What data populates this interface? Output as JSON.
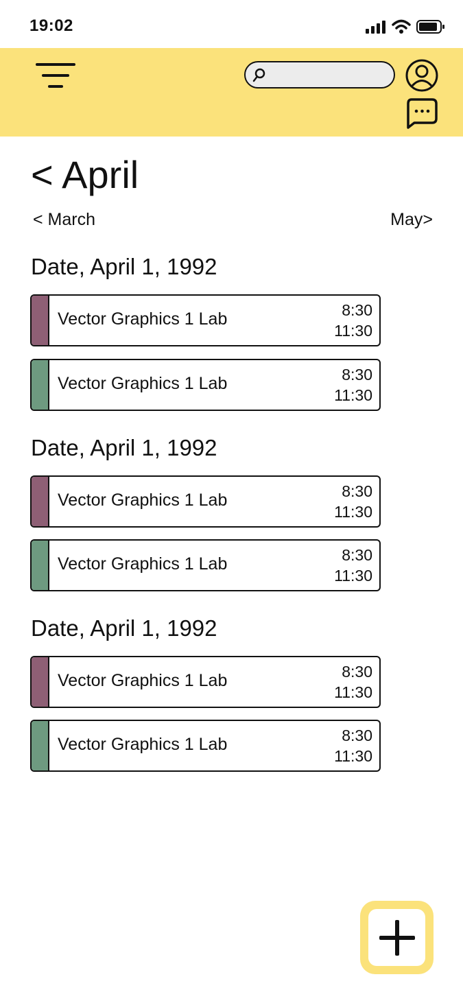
{
  "status_bar": {
    "time": "19:02",
    "icons": [
      "signal-icon",
      "wifi-icon",
      "battery-icon"
    ]
  },
  "header": {
    "background_color": "#fbe27b",
    "search": {
      "placeholder": "",
      "value": ""
    },
    "icons": [
      "menu-icon",
      "search-icon",
      "profile-icon",
      "chat-icon"
    ]
  },
  "month_nav": {
    "title": "< April",
    "prev_label": "< March",
    "next_label": "May>"
  },
  "event_colors": {
    "purple": "#8e5f75",
    "green": "#6e9a80"
  },
  "days": [
    {
      "heading": "Date, April 1, 1992",
      "events": [
        {
          "title": "Vector Graphics 1 Lab",
          "start": "8:30",
          "end": "11:30",
          "color": "#8e5f75"
        },
        {
          "title": "Vector Graphics 1 Lab",
          "start": "8:30",
          "end": "11:30",
          "color": "#6e9a80"
        }
      ]
    },
    {
      "heading": "Date, April 1, 1992",
      "events": [
        {
          "title": "Vector Graphics 1 Lab",
          "start": "8:30",
          "end": "11:30",
          "color": "#8e5f75"
        },
        {
          "title": "Vector Graphics 1 Lab",
          "start": "8:30",
          "end": "11:30",
          "color": "#6e9a80"
        }
      ]
    },
    {
      "heading": "Date, April 1, 1992",
      "events": [
        {
          "title": "Vector Graphics 1 Lab",
          "start": "8:30",
          "end": "11:30",
          "color": "#8e5f75"
        },
        {
          "title": "Vector Graphics 1 Lab",
          "start": "8:30",
          "end": "11:30",
          "color": "#6e9a80"
        }
      ]
    }
  ],
  "fab": {
    "icon": "plus-icon"
  }
}
